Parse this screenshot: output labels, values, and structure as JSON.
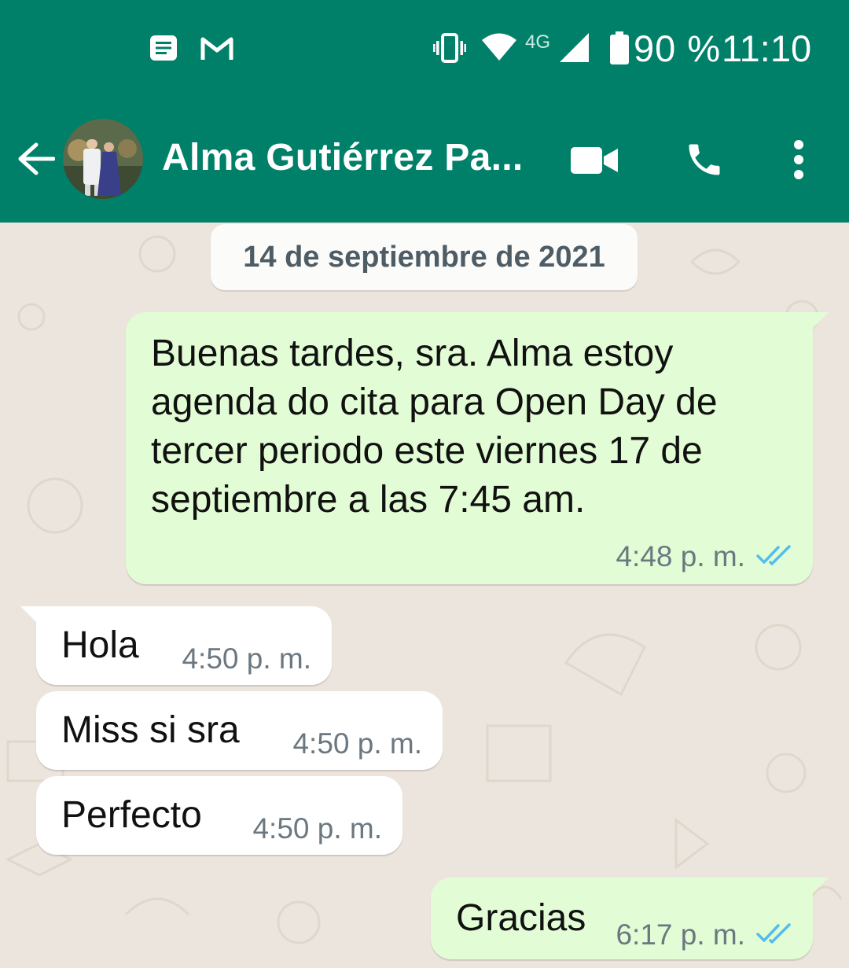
{
  "status_bar": {
    "left_icons": [
      "notes-icon",
      "gmail-icon"
    ],
    "right_icons": [
      "vibrate-icon",
      "wifi-icon",
      "signal-icon",
      "battery-icon"
    ],
    "network": "4G",
    "battery": "90 %",
    "time": "11:10"
  },
  "header": {
    "contact_name": "Alma Gutiérrez Pa...",
    "icons": [
      "back-arrow-icon",
      "avatar",
      "video-call-icon",
      "phone-icon",
      "more-options-icon"
    ]
  },
  "chat": {
    "date_chip": "14 de septiembre de 2021",
    "messages": [
      {
        "direction": "outgoing",
        "text": "Buenas tardes, sra. Alma estoy agenda do cita para Open Day de tercer periodo este viernes 17 de septiembre a las 7:45 am.",
        "time": "4:48 p. m.",
        "status": "read"
      },
      {
        "direction": "incoming",
        "text": "Hola",
        "time": "4:50 p. m."
      },
      {
        "direction": "incoming",
        "text": "Miss si sra",
        "time": "4:50 p. m."
      },
      {
        "direction": "incoming",
        "text": "Perfecto",
        "time": "4:50 p. m."
      },
      {
        "direction": "outgoing",
        "text": "Gracias",
        "time": "6:17 p. m.",
        "status": "read"
      }
    ]
  },
  "colors": {
    "header_bg": "#008069",
    "chat_bg": "#ece5dd",
    "outgoing_bubble": "#e2fdd5",
    "incoming_bubble": "#ffffff",
    "read_ticks": "#53bdeb"
  }
}
